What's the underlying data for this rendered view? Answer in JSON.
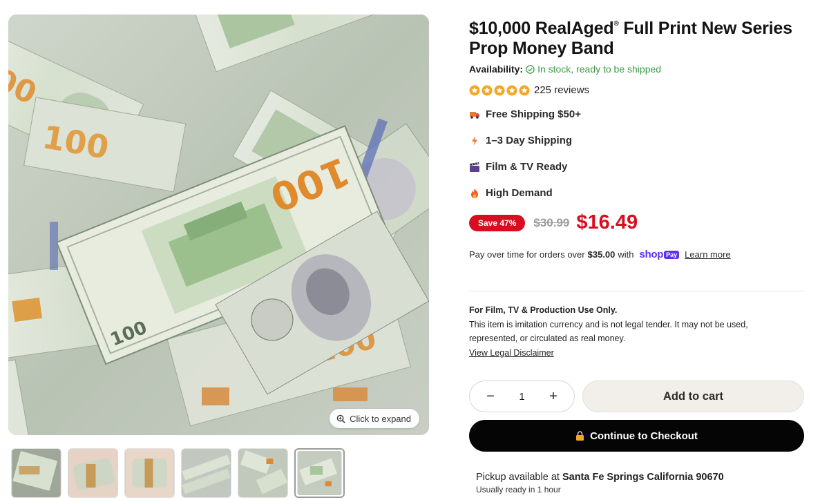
{
  "gallery": {
    "expand_label": "Click to expand",
    "thumbnail_count": 6,
    "active_thumbnail": 6
  },
  "product": {
    "title": "$10,000 RealAged",
    "title_mark": "®",
    "title_rest": " Full Print New Series Prop Money Band",
    "availability_label": "Availability:",
    "availability_value": "In stock, ready to be shipped",
    "rating_stars": 5,
    "reviews": "225 reviews",
    "features": [
      {
        "icon": "truck-icon",
        "label": "Free Shipping $50+"
      },
      {
        "icon": "lightning-icon",
        "label": "1–3 Day Shipping"
      },
      {
        "icon": "clapper-icon",
        "label": "Film & TV Ready"
      },
      {
        "icon": "fire-icon",
        "label": "High Demand"
      }
    ],
    "save_badge": "Save 47%",
    "compare_price": "$30.99",
    "price": "$16.49"
  },
  "payment": {
    "prefix": "Pay over time for orders over",
    "threshold": "$35.00",
    "suffix": "with",
    "shop_text": "shop",
    "pay_text": "Pay",
    "learn_more": "Learn more"
  },
  "disclaimer": {
    "heading": "For Film, TV & Production Use Only.",
    "line1": "This item is imitation currency and is not legal tender. It may not be used,",
    "line2": "represented, or circulated as real money.",
    "link": "View Legal Disclaimer"
  },
  "cart": {
    "quantity": "1",
    "minus": "−",
    "plus": "+",
    "add_label": "Add to cart",
    "checkout_label": "Continue to Checkout"
  },
  "pickup": {
    "prefix": "Pickup available at",
    "location": "Santa Fe Springs California 90670",
    "note": "Usually ready in 1 hour"
  },
  "colors": {
    "sale_red": "#d80d1f",
    "stock_green": "#3d9a46",
    "star_orange": "#f5a623",
    "shop_purple": "#5a31f4",
    "checkout_black": "#050505"
  }
}
